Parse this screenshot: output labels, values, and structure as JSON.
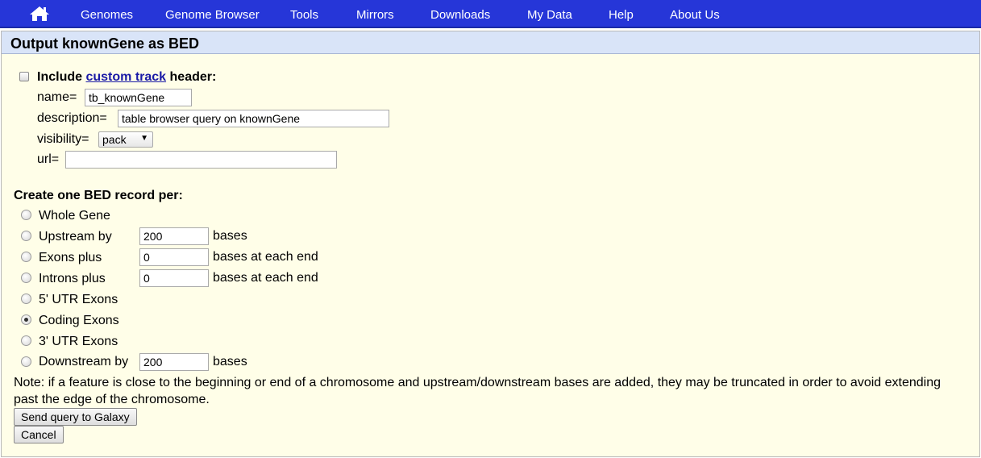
{
  "nav": {
    "home_icon": "home-icon",
    "items": [
      "Genomes",
      "Genome Browser",
      "Tools",
      "Mirrors",
      "Downloads",
      "My Data",
      "Help",
      "About Us"
    ]
  },
  "panel": {
    "title": "Output knownGene as BED"
  },
  "header_section": {
    "include_prefix": "Include",
    "custom_track_link": "custom track",
    "include_suffix": "header:",
    "name_label": "name=",
    "name_value": "tb_knownGene",
    "description_label": "description=",
    "description_value": "table browser query on knownGene",
    "visibility_label": "visibility=",
    "visibility_value": "pack",
    "url_label": "url=",
    "url_value": ""
  },
  "record_section": {
    "heading": "Create one BED record per:",
    "options": [
      {
        "label": "Whole Gene",
        "checked": false
      },
      {
        "label": "Upstream by",
        "value": "200",
        "suffix": "bases",
        "checked": false
      },
      {
        "label": "Exons plus",
        "value": "0",
        "suffix": "bases at each end",
        "checked": false
      },
      {
        "label": "Introns plus",
        "value": "0",
        "suffix": "bases at each end",
        "checked": false
      },
      {
        "label": "5' UTR Exons",
        "checked": false
      },
      {
        "label": "Coding Exons",
        "checked": true
      },
      {
        "label": "3' UTR Exons",
        "checked": false
      },
      {
        "label": "Downstream by",
        "value": "200",
        "suffix": "bases",
        "checked": false
      }
    ]
  },
  "note": "Note: if a feature is close to the beginning or end of a chromosome and upstream/downstream bases are added, they may be truncated in order to avoid extending past the edge of the chromosome.",
  "buttons": {
    "send": "Send query to Galaxy",
    "cancel": "Cancel"
  },
  "colors": {
    "nav_bg": "#2636d8",
    "panel_bg": "#fffee8",
    "panel_header_bg": "#d9e4f8",
    "link": "#1a1aa6"
  }
}
